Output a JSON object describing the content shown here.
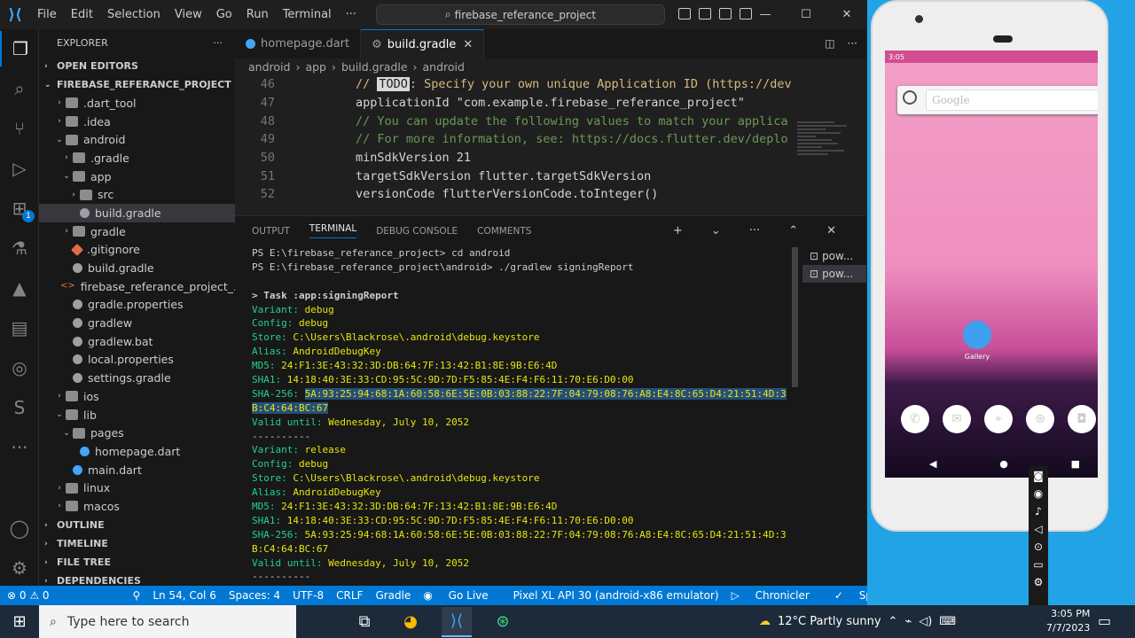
{
  "titlebar": {
    "menu": [
      "File",
      "Edit",
      "Selection",
      "View",
      "Go",
      "Run",
      "Terminal",
      "···"
    ],
    "search": "firebase_referance_project",
    "minimize": "—",
    "maximize": "☐",
    "close": "✕"
  },
  "explorer": {
    "header": "EXPLORER",
    "more": "···",
    "open_editors": "OPEN EDITORS",
    "project": "FIREBASE_REFERANCE_PROJECT",
    "tree": [
      {
        "label": ".dart_tool",
        "depth": 1,
        "chev": "›",
        "icon": "folder"
      },
      {
        "label": ".idea",
        "depth": 1,
        "chev": "›",
        "icon": "folder"
      },
      {
        "label": "android",
        "depth": 1,
        "chev": "⌄",
        "icon": "folder"
      },
      {
        "label": ".gradle",
        "depth": 2,
        "chev": "›",
        "icon": "folder"
      },
      {
        "label": "app",
        "depth": 2,
        "chev": "⌄",
        "icon": "folder"
      },
      {
        "label": "src",
        "depth": 3,
        "chev": "›",
        "icon": "folder"
      },
      {
        "label": "build.gradle",
        "depth": 3,
        "chev": "",
        "icon": "gradle",
        "selected": true
      },
      {
        "label": "gradle",
        "depth": 2,
        "chev": "›",
        "icon": "folder"
      },
      {
        "label": ".gitignore",
        "depth": 2,
        "chev": "",
        "icon": "git"
      },
      {
        "label": "build.gradle",
        "depth": 2,
        "chev": "",
        "icon": "gradle"
      },
      {
        "label": "firebase_referance_project_...",
        "depth": 2,
        "chev": "",
        "icon": "xml"
      },
      {
        "label": "gradle.properties",
        "depth": 2,
        "chev": "",
        "icon": "gradle"
      },
      {
        "label": "gradlew",
        "depth": 2,
        "chev": "",
        "icon": "gradle"
      },
      {
        "label": "gradlew.bat",
        "depth": 2,
        "chev": "",
        "icon": "gradle"
      },
      {
        "label": "local.properties",
        "depth": 2,
        "chev": "",
        "icon": "gradle"
      },
      {
        "label": "settings.gradle",
        "depth": 2,
        "chev": "",
        "icon": "gradle"
      },
      {
        "label": "ios",
        "depth": 1,
        "chev": "›",
        "icon": "folder"
      },
      {
        "label": "lib",
        "depth": 1,
        "chev": "⌄",
        "icon": "folder"
      },
      {
        "label": "pages",
        "depth": 2,
        "chev": "⌄",
        "icon": "folder"
      },
      {
        "label": "homepage.dart",
        "depth": 3,
        "chev": "",
        "icon": "dart"
      },
      {
        "label": "main.dart",
        "depth": 2,
        "chev": "",
        "icon": "dart"
      },
      {
        "label": "linux",
        "depth": 1,
        "chev": "›",
        "icon": "folder"
      },
      {
        "label": "macos",
        "depth": 1,
        "chev": "›",
        "icon": "folder"
      }
    ],
    "bottom_sections": [
      "OUTLINE",
      "TIMELINE",
      "FILE TREE",
      "DEPENDENCIES"
    ]
  },
  "activity_badge": "1",
  "tabs": [
    {
      "label": "homepage.dart",
      "active": false
    },
    {
      "label": "build.gradle",
      "active": true,
      "close": "✕"
    }
  ],
  "breadcrumb": [
    "android",
    "›",
    "app",
    "›",
    "build.gradle",
    "›",
    "android"
  ],
  "code": {
    "lines": [
      {
        "num": "46",
        "todo": "TODO",
        "text": ": Specify your own unique Application ID (https://dev",
        "prefix": "// "
      },
      {
        "num": "47",
        "text": "applicationId \"com.example.firebase_referance_project\""
      },
      {
        "num": "48",
        "text": "// You can update the following values to match your applica"
      },
      {
        "num": "49",
        "text": "// For more information, see: https://docs.flutter.dev/deplo"
      },
      {
        "num": "50",
        "text": "minSdkVersion 21"
      },
      {
        "num": "51",
        "text": "targetSdkVersion flutter.targetSdkVersion"
      },
      {
        "num": "52",
        "text": "versionCode flutterVersionCode.toInteger()"
      }
    ]
  },
  "panel": {
    "tabs": [
      "OUTPUT",
      "TERMINAL",
      "DEBUG CONSOLE",
      "COMMENTS"
    ],
    "active_tab": "TERMINAL",
    "terminals": [
      "pow...",
      "pow..."
    ],
    "lines": [
      {
        "c": "tw",
        "t": "PS E:\\firebase_referance_project> cd android"
      },
      {
        "c": "tw",
        "t": "PS E:\\firebase_referance_project\\android> ./gradlew signingReport"
      },
      {
        "c": "tw",
        "t": ""
      },
      {
        "c": "tw",
        "t": "> Task :app:signingReport"
      },
      {
        "c": "tg",
        "k": "Variant: ",
        "v": "debug"
      },
      {
        "c": "tg",
        "k": "Config: ",
        "v": "debug"
      },
      {
        "c": "tg",
        "k": "Store: ",
        "v": "C:\\Users\\Blackrose\\.android\\debug.keystore"
      },
      {
        "c": "tg",
        "k": "Alias: ",
        "v": "AndroidDebugKey"
      },
      {
        "c": "tg",
        "k": "MD5: ",
        "v": "24:F1:3E:43:32:3D:DB:64:7F:13:42:B1:8E:9B:E6:4D"
      },
      {
        "c": "tg",
        "k": "SHA1: ",
        "v": "14:18:40:3E:33:CD:95:5C:9D:7D:F5:85:4E:F4:F6:11:70:E6:D0:00"
      },
      {
        "c": "tg",
        "k": "SHA-256: ",
        "v": "5A:93:25:94:68:1A:60:58:6E:5E:0B:03:88:22:7F:04:79:08:76:A8:E4:8C:65:D4:21:51:4D:3",
        "hl": true
      },
      {
        "c": "ty",
        "t": "B:C4:64:BC:67",
        "hl": true
      },
      {
        "c": "tg",
        "k": "Valid until: ",
        "v": "Wednesday, July 10, 2052"
      },
      {
        "c": "tw",
        "t": "----------"
      },
      {
        "c": "tg",
        "k": "Variant: ",
        "v": "release"
      },
      {
        "c": "tg",
        "k": "Config: ",
        "v": "debug"
      },
      {
        "c": "tg",
        "k": "Store: ",
        "v": "C:\\Users\\Blackrose\\.android\\debug.keystore"
      },
      {
        "c": "tg",
        "k": "Alias: ",
        "v": "AndroidDebugKey"
      },
      {
        "c": "tg",
        "k": "MD5: ",
        "v": "24:F1:3E:43:32:3D:DB:64:7F:13:42:B1:8E:9B:E6:4D"
      },
      {
        "c": "tg",
        "k": "SHA1: ",
        "v": "14:18:40:3E:33:CD:95:5C:9D:7D:F5:85:4E:F4:F6:11:70:E6:D0:00"
      },
      {
        "c": "tg",
        "k": "SHA-256: ",
        "v": "5A:93:25:94:68:1A:60:58:6E:5E:0B:03:88:22:7F:04:79:08:76:A8:E4:8C:65:D4:21:51:4D:3"
      },
      {
        "c": "ty",
        "t": "B:C4:64:BC:67"
      },
      {
        "c": "tg",
        "k": "Valid until: ",
        "v": "Wednesday, July 10, 2052"
      },
      {
        "c": "tw",
        "t": "----------"
      }
    ]
  },
  "status": {
    "problems": "⊗ 0 ⚠ 0",
    "position": "Ln 54, Col 6",
    "spaces": "Spaces: 4",
    "encoding": "UTF-8",
    "eol": "CRLF",
    "language": "Gradle",
    "golive": "Go Live",
    "device": "Pixel XL API 30 (android-x86 emulator)",
    "chronicler": "Chronicler",
    "spell": "Spell"
  },
  "phone": {
    "time": "3:05",
    "search_placeholder": "Google",
    "gallery": "Gallery"
  },
  "taskbar": {
    "search": "Type here to search",
    "weather": "12°C  Partly sunny",
    "time": "3:05 PM",
    "date": "7/7/2023"
  },
  "colors": {
    "accent": "#0078d4",
    "statusbar": "#0078d4",
    "terminal_green": "#23d18b",
    "terminal_yellow": "#e5e510",
    "selection": "#264f78"
  }
}
